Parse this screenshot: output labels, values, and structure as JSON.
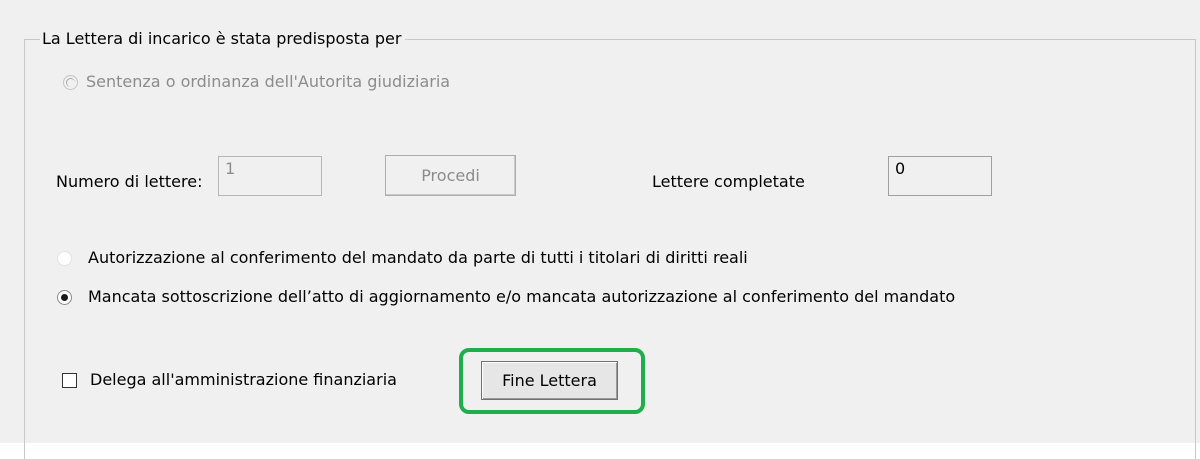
{
  "group": {
    "title": "La Lettera di incarico è stata predisposta per"
  },
  "options": {
    "sentenza": {
      "label": "Sentenza o ordinanza dell'Autorita giudiziaria",
      "enabled": false,
      "selected": false
    },
    "autorizzazione": {
      "label": "Autorizzazione al conferimento del mandato da parte di tutti i titolari di diritti reali",
      "enabled": true,
      "selected": false
    },
    "mancata": {
      "label": "Mancata sottoscrizione dell’atto di aggiornamento e/o mancata autorizzazione al conferimento del mandato",
      "enabled": true,
      "selected": true
    }
  },
  "numero_lettere": {
    "label": "Numero di lettere:",
    "value": "1"
  },
  "procedi_button": {
    "label": "Procedi"
  },
  "lettere_completate": {
    "label": "Lettere completate",
    "value": "0"
  },
  "delega": {
    "label": "Delega all'amministrazione finanziaria",
    "checked": false
  },
  "fine_lettera_button": {
    "label": "Fine Lettera"
  },
  "colors": {
    "panel_background": "#f0f0f0",
    "highlight_border": "#1fae4b",
    "disabled_text": "#8c8c8c"
  }
}
